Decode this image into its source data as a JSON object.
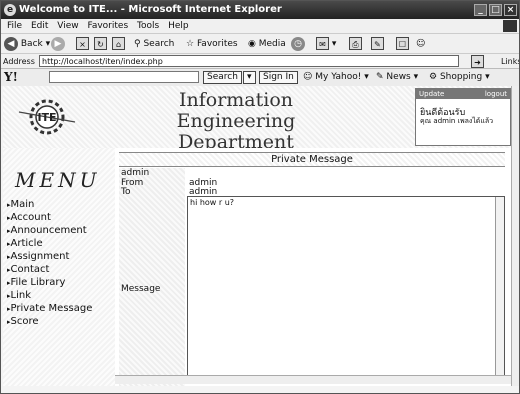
{
  "window": {
    "title": "Welcome to ITE... - Microsoft Internet Explorer",
    "controls": {
      "min": "_",
      "max": "□",
      "close": "×"
    }
  },
  "menubar": [
    "File",
    "Edit",
    "View",
    "Favorites",
    "Tools",
    "Help"
  ],
  "toolbar": {
    "back": "Back",
    "search": "Search",
    "favorites": "Favorites",
    "media": "Media"
  },
  "address": {
    "label": "Address",
    "url": "http://localhost/iten/index.php",
    "links": "Links"
  },
  "yahoo": {
    "logo": "Y!",
    "search_button": "Search",
    "signin": "Sign In",
    "my_yahoo": "My Yahoo!",
    "news": "News",
    "shopping": "Shopping"
  },
  "banner": {
    "logo_text": "ITE",
    "dept_line1": "Information Engineering",
    "dept_line2": "Department",
    "update": {
      "header": "Update",
      "right": "logout",
      "line1": "ยินดีต้อนรับ",
      "line2": "คุณ admin เพลงได้แล้ว"
    }
  },
  "sidebar": {
    "title": "MENU",
    "items": [
      "Main",
      "Account",
      "Announcement",
      "Article",
      "Assignment",
      "Contact",
      "File Library",
      "Link",
      "Private Message",
      "Score"
    ]
  },
  "content": {
    "section_title": "Private Message",
    "user": "admin",
    "from_label": "From",
    "from_value": "admin",
    "to_label": "To",
    "to_value": "admin",
    "message_label": "Message",
    "message_value": "hi how r u?"
  }
}
